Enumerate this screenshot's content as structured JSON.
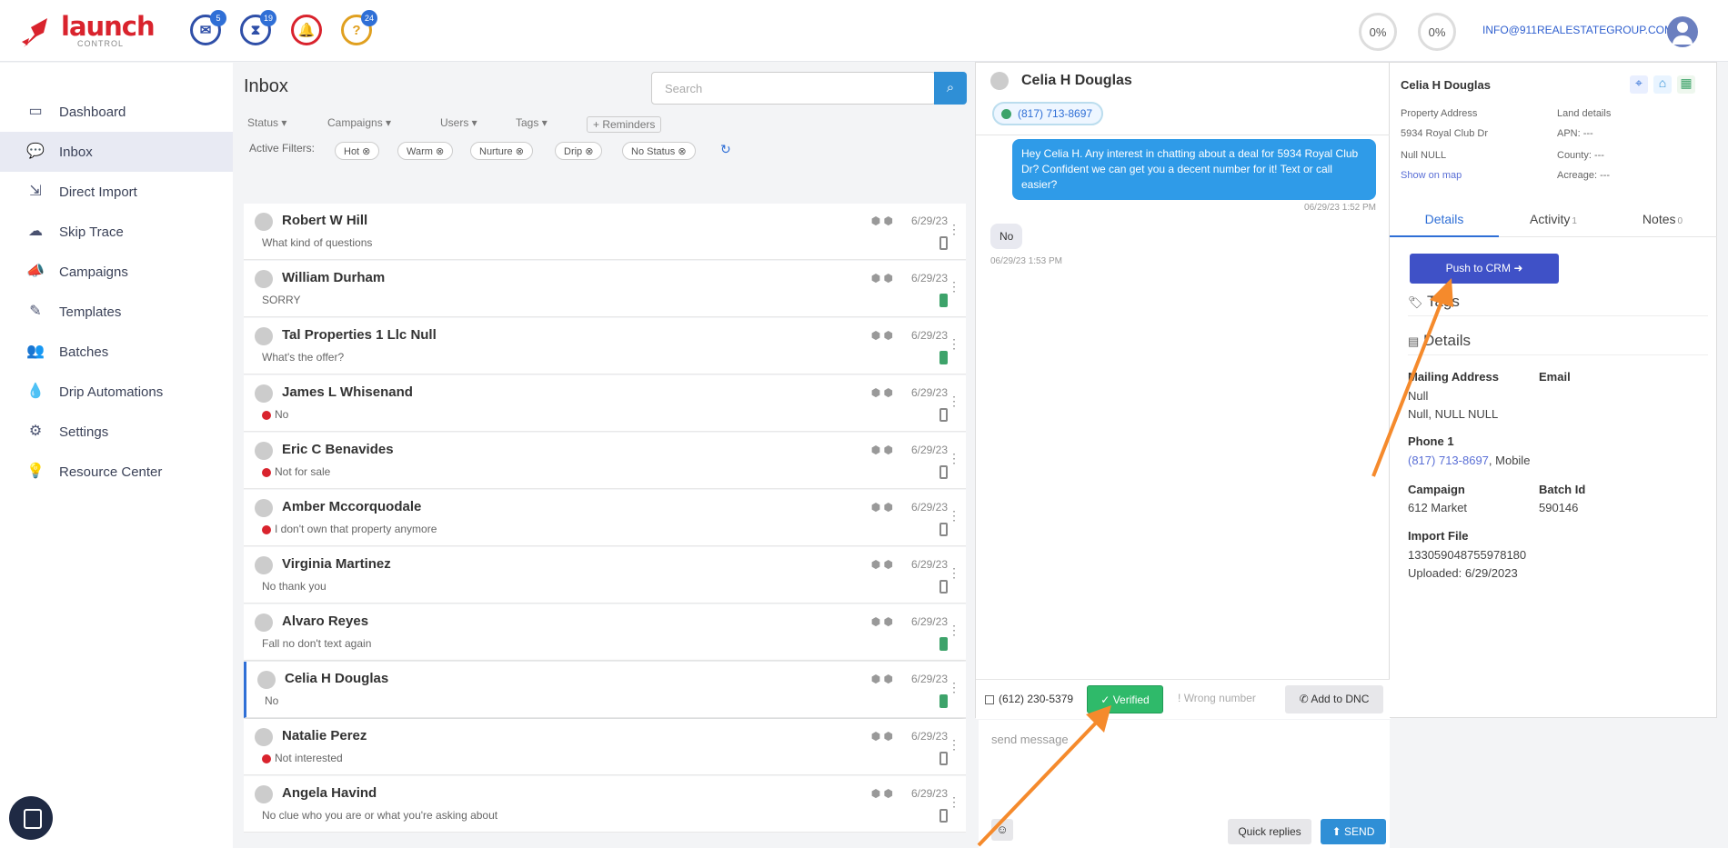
{
  "brand": {
    "name": "launch",
    "sub": "CONTROL",
    "color": "#d9232d"
  },
  "header": {
    "notifications": [
      {
        "icon": "mail-icon",
        "count": "5",
        "color": "#2f4fa8"
      },
      {
        "icon": "hourglass-icon",
        "count": "19",
        "color": "#2f4fa8"
      },
      {
        "icon": "bell-icon",
        "count": "",
        "color": "#d9232d"
      },
      {
        "icon": "help-icon",
        "count": "24",
        "color": "#e0a020"
      }
    ],
    "pct1": "0%",
    "pct2": "0%",
    "email": "INFO@911REALESTATEGROUP.COM"
  },
  "sidebar": {
    "items": [
      {
        "label": "Dashboard",
        "icon": "monitor-icon"
      },
      {
        "label": "Inbox",
        "icon": "chat-icon"
      },
      {
        "label": "Direct Import",
        "icon": "import-icon"
      },
      {
        "label": "Skip Trace",
        "icon": "cloud-upload-icon"
      },
      {
        "label": "Campaigns",
        "icon": "megaphone-icon"
      },
      {
        "label": "Templates",
        "icon": "edit-icon"
      },
      {
        "label": "Batches",
        "icon": "users-icon"
      },
      {
        "label": "Drip Automations",
        "icon": "drop-icon"
      },
      {
        "label": "Settings",
        "icon": "gear-icon"
      },
      {
        "label": "Resource Center",
        "icon": "lightbulb-icon"
      }
    ]
  },
  "inbox": {
    "title": "Inbox",
    "search_placeholder": "Search",
    "filters": [
      "Status",
      "Campaigns",
      "Users",
      "Tags",
      "+ Reminders"
    ],
    "active_filters_label": "Active Filters:",
    "chips": [
      "Hot",
      "Warm",
      "Nurture",
      "Drip",
      "No Status"
    ],
    "rows": [
      {
        "name": "Robert W Hill",
        "preview": "What kind of questions",
        "date": "6/29/23",
        "dot": false,
        "green": false
      },
      {
        "name": "William Durham",
        "preview": "SORRY",
        "date": "6/29/23",
        "dot": false,
        "green": true
      },
      {
        "name": "Tal Properties 1 Llc Null",
        "preview": "What's the offer?",
        "date": "6/29/23",
        "dot": false,
        "green": true
      },
      {
        "name": "James L Whisenand",
        "preview": "No",
        "date": "6/29/23",
        "dot": true,
        "green": false
      },
      {
        "name": "Eric C Benavides",
        "preview": "Not for sale",
        "date": "6/29/23",
        "dot": true,
        "green": false
      },
      {
        "name": "Amber Mccorquodale",
        "preview": "I don't own that property anymore",
        "date": "6/29/23",
        "dot": true,
        "green": false
      },
      {
        "name": "Virginia Martinez",
        "preview": "No thank you",
        "date": "6/29/23",
        "dot": false,
        "green": false
      },
      {
        "name": "Alvaro Reyes",
        "preview": "Fall no don't text again",
        "date": "6/29/23",
        "dot": false,
        "green": true
      },
      {
        "name": "Celia H Douglas",
        "preview": "No",
        "date": "6/29/23",
        "dot": false,
        "green": true,
        "selected": true
      },
      {
        "name": "Natalie Perez",
        "preview": "Not interested",
        "date": "6/29/23",
        "dot": true,
        "green": false
      },
      {
        "name": "Angela Havind",
        "preview": "No clue who you are or what you're asking about",
        "date": "6/29/23",
        "dot": false,
        "green": false
      }
    ]
  },
  "chat": {
    "name": "Celia H Douglas",
    "phone_pill": "(817) 713-8697",
    "outgoing": "Hey Celia H. Any interest in chatting about a deal for 5934 Royal Club Dr? Confident we can get you a decent number for it! Text or call easier?",
    "outgoing_time": "06/29/23 1:52 PM",
    "incoming": "No",
    "incoming_time": "06/29/23 1:53 PM",
    "footer_phone": "(612) 230-5379",
    "verified": "Verified",
    "wrong_number": "Wrong number",
    "add_dnc": "Add to DNC",
    "send_placeholder": "send message",
    "quick_replies": "Quick replies",
    "send": "SEND"
  },
  "details": {
    "name": "Celia H Douglas",
    "property_address_label": "Property Address",
    "land_details_label": "Land details",
    "address_line1": "5934 Royal Club Dr",
    "address_line2": "Null NULL",
    "apn": "APN: ---",
    "county": "County: ---",
    "acreage": "Acreage: ---",
    "show_map": "Show on map",
    "tabs": [
      {
        "label": "Details",
        "count": ""
      },
      {
        "label": "Activity",
        "count": "1"
      },
      {
        "label": "Notes",
        "count": "0"
      }
    ],
    "push_crm": "Push to CRM",
    "tags_heading": "Tags",
    "details_heading": "Details",
    "mailing_label": "Mailing Address",
    "mailing_val1": "Null",
    "mailing_val2": "Null, NULL NULL",
    "email_label": "Email",
    "phone_label": "Phone 1",
    "phone_val": "(817) 713-8697",
    "phone_type": ", Mobile",
    "campaign_label": "Campaign",
    "campaign_val": "612 Market",
    "batch_label": "Batch Id",
    "batch_val": "590146",
    "import_label": "Import File",
    "import_val": "133059048755978180",
    "uploaded": "Uploaded: 6/29/2023"
  },
  "colors": {
    "accent": "#2f6fd6",
    "verified": "#2fba6a",
    "push": "#3f51c7",
    "arrow": "#f58a2c"
  }
}
